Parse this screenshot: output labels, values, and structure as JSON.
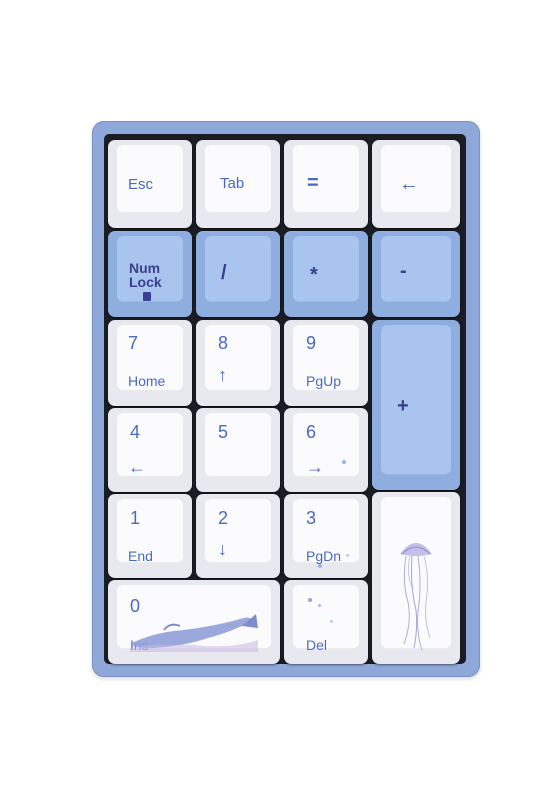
{
  "keys": {
    "esc": "Esc",
    "tab": "Tab",
    "equals": "=",
    "backspace_arrow": "←",
    "numlock_line1": "Num",
    "numlock_line2": "Lock",
    "slash": "/",
    "star": "*",
    "minus": "-",
    "k7_num": "7",
    "k7_sub": "Home",
    "k8_num": "8",
    "k8_sub": "↑",
    "k9_num": "9",
    "k9_sub": "PgUp",
    "plus": "+",
    "k4_num": "4",
    "k4_sub": "←",
    "k5_num": "5",
    "k6_num": "6",
    "k6_sub": "→",
    "k1_num": "1",
    "k1_sub": "End",
    "k2_num": "2",
    "k2_sub": "↓",
    "k3_num": "3",
    "k3_sub": "PgDn",
    "k0_num": "0",
    "k0_sub": "Ins",
    "del": "Del"
  },
  "colors": {
    "case": "#8fa8da",
    "plate": "#1b1d24",
    "white_keycap": "#fbfbfd",
    "blue_keycap": "#a9c4ee",
    "legend": "#4a69c4"
  },
  "icons": [
    "whale-illustration",
    "jellyfish-illustration",
    "numlock-indicator-icon"
  ]
}
